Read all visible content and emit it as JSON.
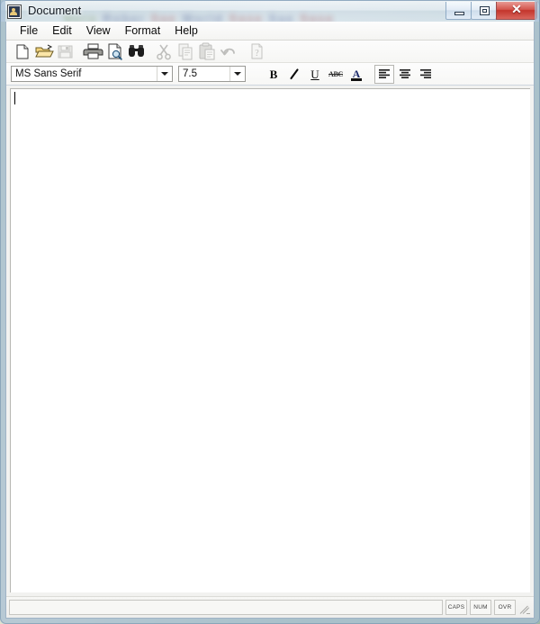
{
  "window": {
    "title": "Document",
    "app_icon": "document-picture-icon",
    "glass_bleed_text": "Nero Rober Sae World Sase Sae Sase",
    "controls": {
      "minimize_label": "–",
      "maximize_label": "❐",
      "close_label": "✕",
      "minimize_name": "minimize-button",
      "maximize_name": "maximize-button",
      "close_name": "close-button"
    },
    "colors": {
      "close_red": "#c3352c",
      "glass_blue": "#a8c0d6",
      "frame_border": "#9fb3c6",
      "client_bg": "#f2f2f0",
      "editor_bg": "#ffffff"
    }
  },
  "menubar": {
    "items": [
      {
        "label": "File",
        "name": "menu-file"
      },
      {
        "label": "Edit",
        "name": "menu-edit"
      },
      {
        "label": "View",
        "name": "menu-view"
      },
      {
        "label": "Format",
        "name": "menu-format"
      },
      {
        "label": "Help",
        "name": "menu-help"
      }
    ]
  },
  "toolbar": {
    "buttons": [
      {
        "name": "new-icon",
        "title": "New",
        "enabled": true
      },
      {
        "name": "open-icon",
        "title": "Open",
        "enabled": true
      },
      {
        "name": "save-icon",
        "title": "Save",
        "enabled": false
      },
      {
        "separator": true
      },
      {
        "name": "print-icon",
        "title": "Print",
        "enabled": true
      },
      {
        "name": "print-preview-icon",
        "title": "Print Preview",
        "enabled": true
      },
      {
        "name": "find-icon",
        "title": "Find",
        "enabled": true
      },
      {
        "separator": true
      },
      {
        "name": "cut-icon",
        "title": "Cut",
        "enabled": false
      },
      {
        "name": "copy-icon",
        "title": "Copy",
        "enabled": false
      },
      {
        "name": "paste-icon",
        "title": "Paste",
        "enabled": false
      },
      {
        "name": "undo-icon",
        "title": "Undo",
        "enabled": false
      },
      {
        "separator": true
      },
      {
        "name": "about-icon",
        "title": "About",
        "enabled": false
      }
    ]
  },
  "formatbar": {
    "font": {
      "value": "MS Sans Serif",
      "name": "font-family-combo"
    },
    "size": {
      "value": "7.5",
      "name": "font-size-combo"
    },
    "buttons": [
      {
        "name": "bold-button",
        "glyph": "B",
        "style": "bold",
        "pressed": false
      },
      {
        "name": "italic-button",
        "glyph": "I",
        "style": "italic",
        "pressed": false
      },
      {
        "name": "underline-button",
        "glyph": "U",
        "style": "underline",
        "pressed": false
      },
      {
        "name": "strikethrough-button",
        "glyph": "ABC",
        "style": "strike",
        "pressed": false
      },
      {
        "name": "font-color-button",
        "glyph": "A",
        "style": "color",
        "pressed": false
      },
      {
        "name": "align-left-button",
        "glyph": "",
        "style": "align-left",
        "pressed": true
      },
      {
        "name": "align-center-button",
        "glyph": "",
        "style": "align-center",
        "pressed": false
      },
      {
        "name": "align-right-button",
        "glyph": "",
        "style": "align-right",
        "pressed": false
      }
    ]
  },
  "editor": {
    "content": "",
    "caret_visible": true
  },
  "statusbar": {
    "message": "",
    "panes": [
      {
        "label": "CAPS",
        "name": "status-caps"
      },
      {
        "label": "NUM",
        "name": "status-num"
      },
      {
        "label": "OVR",
        "name": "status-ovr"
      }
    ]
  }
}
